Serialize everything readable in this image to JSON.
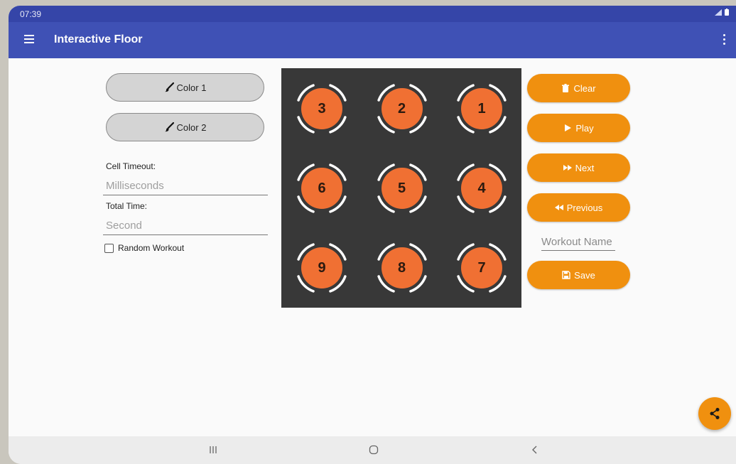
{
  "status_bar": {
    "time": "07:39",
    "icons": "signal-icon battery-icon"
  },
  "app_bar": {
    "title": "Interactive Floor",
    "menu_icon": "menu-icon",
    "overflow_icon": "more-vert-icon"
  },
  "left_panel": {
    "color1_label": "Color 1",
    "color2_label": "Color 2",
    "brush_icon": "brush-icon",
    "cell_timeout_label": "Cell Timeout:",
    "cell_timeout_value": "",
    "cell_timeout_placeholder": "Milliseconds",
    "total_time_label": "Total Time:",
    "total_time_value": "",
    "total_time_placeholder": "Second",
    "random_workout_label": "Random Workout",
    "random_workout_checked": false
  },
  "grid": {
    "colors": {
      "background": "#383838",
      "tile": "#f07033",
      "arc": "#ffffff"
    },
    "cells": [
      {
        "number": "3"
      },
      {
        "number": "2"
      },
      {
        "number": "1"
      },
      {
        "number": "6"
      },
      {
        "number": "5"
      },
      {
        "number": "4"
      },
      {
        "number": "9"
      },
      {
        "number": "8"
      },
      {
        "number": "7"
      }
    ]
  },
  "right_panel": {
    "clear_label": "Clear",
    "play_label": "Play",
    "next_label": "Next",
    "previous_label": "Previous",
    "workout_name_value": "",
    "workout_name_placeholder": "Workout Name",
    "save_label": "Save"
  },
  "fab": {
    "icon": "share-icon"
  },
  "nav_bar": {
    "recents": "recents-icon",
    "home": "home-icon",
    "back": "back-icon"
  },
  "colors": {
    "primary": "#3f51b5",
    "status_bar": "#3545a8",
    "accent": "#f0900f",
    "button_gray": "#d4d4d4"
  }
}
